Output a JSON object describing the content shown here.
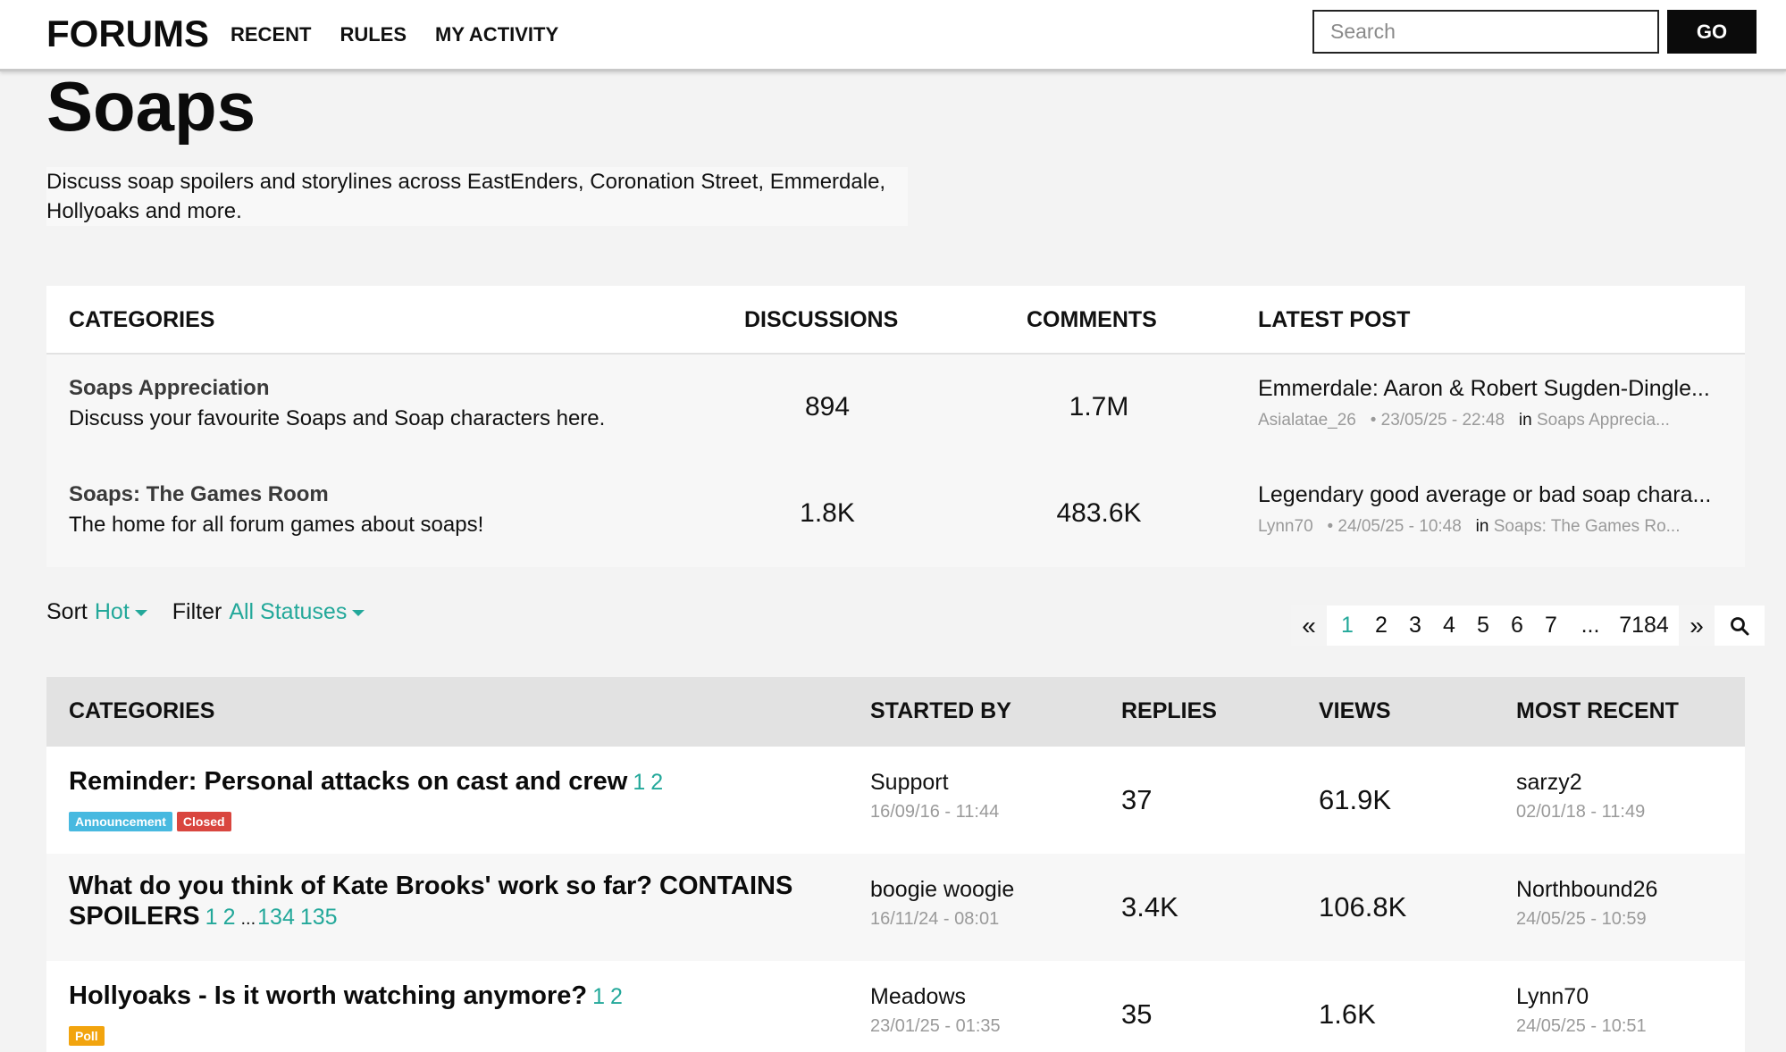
{
  "header": {
    "logo": "FORUMS",
    "nav": [
      "RECENT",
      "RULES",
      "MY ACTIVITY"
    ],
    "search_placeholder": "Search",
    "go_label": "GO"
  },
  "page": {
    "title": "Soaps",
    "description": "Discuss soap spoilers and storylines across EastEnders, Coronation Street, Emmerdale, Hollyoaks and more."
  },
  "categories": {
    "headers": [
      "CATEGORIES",
      "DISCUSSIONS",
      "COMMENTS",
      "LATEST POST"
    ],
    "rows": [
      {
        "name": "Soaps Appreciation",
        "subtitle": "Discuss your favourite Soaps and Soap characters here.",
        "discussions": "894",
        "comments": "1.7M",
        "latest_title": "Emmerdale: Aaron & Robert Sugden-Dingle...",
        "latest_user": "Asialatae_26",
        "latest_time": "• 23/05/25 - 22:48",
        "latest_in": "in",
        "latest_category": "Soaps Apprecia..."
      },
      {
        "name": "Soaps: The Games Room",
        "subtitle": "The home for all forum games about soaps!",
        "discussions": "1.8K",
        "comments": "483.6K",
        "latest_title": "Legendary good average or bad soap chara...",
        "latest_user": "Lynn70",
        "latest_time": "• 24/05/25 - 10:48",
        "latest_in": "in",
        "latest_category": "Soaps: The Games Ro..."
      }
    ]
  },
  "controls": {
    "sort_label": "Sort",
    "sort_value": "Hot",
    "filter_label": "Filter",
    "filter_value": "All Statuses"
  },
  "pager": {
    "prev": "«",
    "pages": [
      "1",
      "2",
      "3",
      "4",
      "5",
      "6",
      "7",
      "...",
      "7184"
    ],
    "current": "1",
    "next": "»"
  },
  "discussions": {
    "headers": [
      "CATEGORIES",
      "STARTED BY",
      "REPLIES",
      "VIEWS",
      "MOST RECENT"
    ],
    "rows": [
      {
        "title": "Reminder: Personal attacks on cast and crew",
        "pages": [
          "1",
          "2"
        ],
        "badges": [
          {
            "label": "Announcement",
            "kind": "ann"
          },
          {
            "label": "Closed",
            "kind": "closed"
          }
        ],
        "started_by": "Support",
        "started_time": "16/09/16 - 11:44",
        "replies": "37",
        "views": "61.9K",
        "recent_user": "sarzy2",
        "recent_time": "02/01/18 - 11:49"
      },
      {
        "title": "What do you think of Kate Brooks' work so far? CONTAINS SPOILERS",
        "pages": [
          "1",
          "2",
          "...",
          "134",
          "135"
        ],
        "badges": [],
        "started_by": "boogie woogie",
        "started_time": "16/11/24 - 08:01",
        "replies": "3.4K",
        "views": "106.8K",
        "recent_user": "Northbound26",
        "recent_time": "24/05/25 - 10:59"
      },
      {
        "title": "Hollyoaks - Is it worth watching anymore?",
        "pages": [
          "1",
          "2"
        ],
        "badges": [
          {
            "label": "Poll",
            "kind": "poll"
          }
        ],
        "started_by": "Meadows",
        "started_time": "23/01/25 - 01:35",
        "replies": "35",
        "views": "1.6K",
        "recent_user": "Lynn70",
        "recent_time": "24/05/25 - 10:51"
      }
    ]
  },
  "colors": {
    "accent": "#23a89a",
    "announcement": "#47b9e0",
    "closed": "#d9463f",
    "poll": "#f2a40e"
  },
  "icons": {
    "search": "magnifier-icon",
    "caret": "caret-down-icon"
  }
}
